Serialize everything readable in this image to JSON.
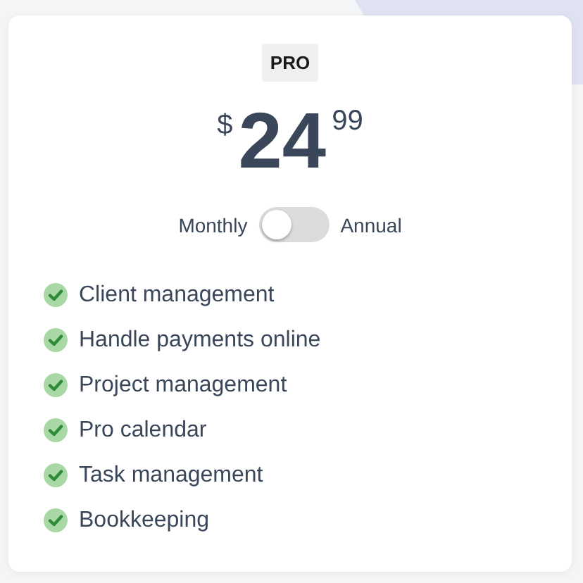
{
  "plan": {
    "badge": "PRO",
    "currency": "$",
    "price_whole": "24",
    "price_cents": "99"
  },
  "billing_toggle": {
    "left_label": "Monthly",
    "right_label": "Annual",
    "on": false
  },
  "features": [
    {
      "label": "Client management",
      "included": true
    },
    {
      "label": "Handle payments online",
      "included": true
    },
    {
      "label": "Project management",
      "included": true
    },
    {
      "label": "Pro calendar",
      "included": true
    },
    {
      "label": "Task management",
      "included": true
    },
    {
      "label": "Bookkeeping",
      "included": true
    }
  ]
}
